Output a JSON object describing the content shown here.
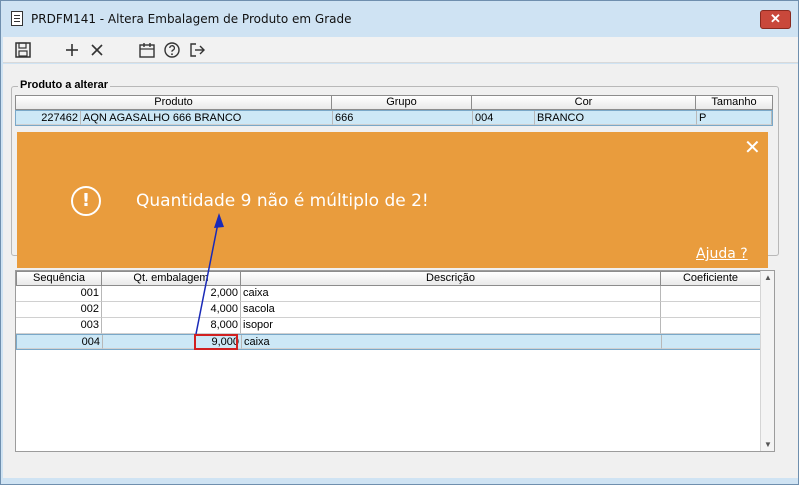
{
  "window": {
    "title": "PRDFM141 - Altera Embalagem de Produto em Grade",
    "close_label": "✕"
  },
  "toolbar": {
    "icons": [
      "save-icon",
      "add-icon",
      "delete-icon",
      "calendar-icon",
      "help-icon",
      "exit-icon"
    ]
  },
  "product_group": {
    "title": "Produto a alterar",
    "columns": [
      "Produto",
      "Grupo",
      "Cor",
      "Tamanho"
    ],
    "row": {
      "codigo": "227462",
      "produto": "AQN AGASALHO 666 BRANCO",
      "grupo": "666",
      "cor_codigo": "004",
      "cor": "BRANCO",
      "tamanho": "P"
    }
  },
  "packaging_grid": {
    "columns": [
      "Sequência",
      "Qt. embalagem",
      "Descrição",
      "Coeficiente"
    ],
    "rows": [
      {
        "sequencia": "001",
        "qt": "2,000",
        "descricao": "caixa",
        "coeficiente": ""
      },
      {
        "sequencia": "002",
        "qt": "4,000",
        "descricao": "sacola",
        "coeficiente": ""
      },
      {
        "sequencia": "003",
        "qt": "8,000",
        "descricao": "isopor",
        "coeficiente": ""
      },
      {
        "sequencia": "004",
        "qt": "9,000",
        "descricao": "caixa",
        "coeficiente": ""
      }
    ]
  },
  "toast": {
    "message": "Quantidade 9 não é múltiplo de 2!",
    "help_link": "Ajuda ?",
    "icon": "!",
    "close": "✕",
    "color": "#e99c3d"
  },
  "colors": {
    "selection": "#cde8f6",
    "highlight": "#d12020",
    "arrow": "#1a2ab8"
  }
}
